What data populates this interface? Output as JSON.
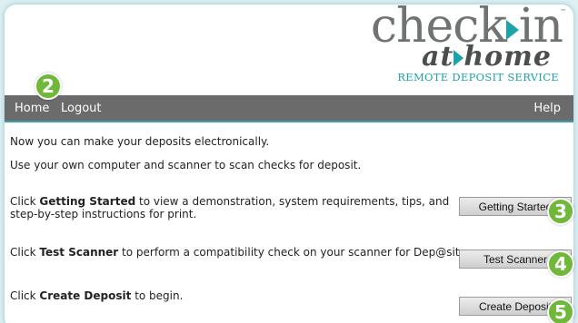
{
  "logo": {
    "line1": "check",
    "line1_end": "in",
    "tm": "™",
    "line2_start": "at",
    "line2_end": "home",
    "subtitle": "REMOTE DEPOSIT SERVICE"
  },
  "nav": {
    "home": "Home",
    "logout": "Logout",
    "help": "Help"
  },
  "content": {
    "intro1": "Now you can make your deposits electronically.",
    "intro2": "Use your own computer and scanner to scan checks for deposit.",
    "getting_started_pre": "Click ",
    "getting_started_bold": "Getting Started",
    "getting_started_post": " to view a demonstration, system requirements, tips, and step-by-step instructions for print.",
    "test_scanner_pre": "Click ",
    "test_scanner_bold": "Test Scanner",
    "test_scanner_post": " to perform a compatibility check on your scanner for Dep@sit.",
    "create_deposit_pre": "Click ",
    "create_deposit_bold": "Create Deposit",
    "create_deposit_post": " to begin."
  },
  "buttons": {
    "getting_started": "Getting Started",
    "test_scanner": "Test Scanner",
    "create_deposit": "Create Deposit"
  },
  "badges": {
    "b2": "2",
    "b3": "3",
    "b4": "4",
    "b5": "5"
  },
  "colors": {
    "nav_bg": "#6b6b6b",
    "accent_teal": "#1aa3a8",
    "badge_green": "#6fb83a"
  }
}
